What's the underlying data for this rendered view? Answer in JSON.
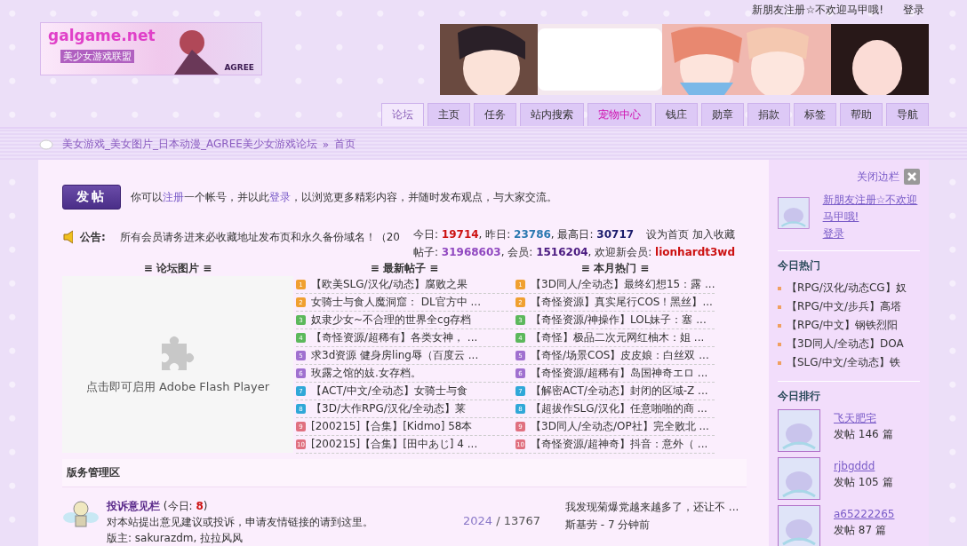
{
  "top_links": [
    "新朋友注册☆不欢迎马甲哦!",
    "登录"
  ],
  "logo": {
    "title": "galgame.net",
    "subtitle": "美少女游戏联盟",
    "badge": "AGREE"
  },
  "banner": {
    "kind": "picture"
  },
  "nav_tabs": [
    {
      "label": "论坛",
      "selected": true,
      "highlight": false
    },
    {
      "label": "主页",
      "selected": false,
      "highlight": false
    },
    {
      "label": "任务",
      "selected": false,
      "highlight": false
    },
    {
      "label": "站内搜索",
      "selected": false,
      "highlight": false
    },
    {
      "label": "宠物中心",
      "selected": false,
      "highlight": true
    },
    {
      "label": "钱庄",
      "selected": false,
      "highlight": false
    },
    {
      "label": "勋章",
      "selected": false,
      "highlight": false
    },
    {
      "label": "捐款",
      "selected": false,
      "highlight": false
    },
    {
      "label": "标签",
      "selected": false,
      "highlight": false
    },
    {
      "label": "帮助",
      "selected": false,
      "highlight": false
    },
    {
      "label": "导航",
      "selected": false,
      "highlight": false
    }
  ],
  "breadcrumb": {
    "path": "美女游戏_美女图片_日本动漫_AGREE美少女游戏论坛",
    "separator": "»",
    "current": "首页"
  },
  "post_button": "发帖",
  "intro": {
    "before": "你可以",
    "register": "注册",
    "middle": "一个帐号，并以此",
    "login": "登录",
    "after": "，以浏览更多精彩内容，并随时发布观点，与大家交流。"
  },
  "notice": {
    "label": "公告:",
    "text": "所有会员请务进来必收藏地址发布页和永久备份域名！（20"
  },
  "stats": {
    "line1": [
      {
        "label": "今日: ",
        "value": "19714",
        "color": "#cc1111"
      },
      {
        "label": ", 昨日: ",
        "value": "23786",
        "color": "#2a78b0"
      },
      {
        "label": ", 最高日: ",
        "value": "30717",
        "color": "#1c1c6c"
      }
    ],
    "links": [
      "设为首页",
      "加入收藏"
    ],
    "line2": [
      {
        "label": "帖子: ",
        "value": "31968603",
        "color": "#9048c0"
      },
      {
        "label": ", 会员: ",
        "value": "1516204",
        "color": "#4a1a80"
      },
      {
        "label": ", 欢迎新会员: ",
        "value": "lionhardt3wd",
        "color": "#cc1111"
      }
    ]
  },
  "picture_panel": {
    "title": "≡ 论坛图片 ≡",
    "message": "点击即可启用 Adobe Flash Player"
  },
  "latest": {
    "title": "≡ 最新帖子 ≡",
    "items": [
      {
        "rank": "1",
        "color": "#f0a030",
        "text": "【欧美SLG/汉化/动态】腐败之果"
      },
      {
        "rank": "2",
        "color": "#f0a030",
        "text": "女骑士与食人魔洞窟： DL官方中 ..."
      },
      {
        "rank": "3",
        "color": "#5cb85c",
        "text": "奴隶少女~不合理的世界全cg存档"
      },
      {
        "rank": "4",
        "color": "#5cb85c",
        "text": "【奇怪资源/超稀有】各类女神， ..."
      },
      {
        "rank": "5",
        "color": "#a070d0",
        "text": "求3d资源 健身房ling辱（百度云 ..."
      },
      {
        "rank": "6",
        "color": "#a070d0",
        "text": "玫露之馆的妓.女存档。"
      },
      {
        "rank": "7",
        "color": "#30a8d8",
        "text": "【ACT/中文/全动态】女骑士与食"
      },
      {
        "rank": "8",
        "color": "#30a8d8",
        "text": "【3D/大作RPG/汉化/全动态】莱"
      },
      {
        "rank": "9",
        "color": "#e07080",
        "text": "[200215]【合集】[Kidmo] 58本"
      },
      {
        "rank": "10",
        "color": "#e07080",
        "text": "[200215]【合集】[田中あじ] 4 ..."
      }
    ]
  },
  "hot": {
    "title": "≡ 本月热门 ≡",
    "items": [
      {
        "rank": "1",
        "color": "#f0a030",
        "text": "【3D同人/全动态】最终幻想15：露 ..."
      },
      {
        "rank": "2",
        "color": "#f0a030",
        "text": "【奇怪资源】真实尾行COS！黑丝】..."
      },
      {
        "rank": "3",
        "color": "#5cb85c",
        "text": "【奇怪资源/神操作】LOL妹子：塞 ..."
      },
      {
        "rank": "4",
        "color": "#5cb85c",
        "text": "【奇怪】极品二次元网红柚木：姐 ..."
      },
      {
        "rank": "5",
        "color": "#a070d0",
        "text": "【奇怪/场景COS】皮皮娘：白丝双 ..."
      },
      {
        "rank": "6",
        "color": "#a070d0",
        "text": "【奇怪资源/超稀有】岛国神奇エロ ..."
      },
      {
        "rank": "7",
        "color": "#30a8d8",
        "text": "【解密ACT/全动态】封闭的区域-Z ..."
      },
      {
        "rank": "8",
        "color": "#30a8d8",
        "text": "【超拔作SLG/汉化】任意啪啪的商 ..."
      },
      {
        "rank": "9",
        "color": "#e07080",
        "text": "【3D同人/全动态/OP社】完全败北 ..."
      },
      {
        "rank": "10",
        "color": "#e07080",
        "text": "【奇怪资源/超神奇】抖音：意外（ ..."
      }
    ]
  },
  "section": {
    "title": "版务管理区"
  },
  "forum": {
    "name": "投诉意见栏",
    "today_open": "(今日: ",
    "today": "8",
    "today_close": ")",
    "description": "对本站提出意见建议或投诉，申请友情链接的请到这里。",
    "moderators": "版主: sakurazdm, 拉拉风风",
    "topics": "2024",
    "separator": " / ",
    "posts": "13767",
    "last_post": "我发现菊爆党越来越多了，还让不 ...",
    "last_by": "斯基劳 - 7 分钟前"
  },
  "sidebar": {
    "close_label": "关闭边栏",
    "welcome_link": "新朋友注册☆不欢迎马甲哦!",
    "login_link": "登录",
    "hot_title": "今日热门",
    "hot_items": [
      "【RPG/汉化/动态CG】奴",
      "【RPG/中文/步兵】高塔",
      "【RPG/中文】钢铁烈阳",
      "【3D同人/全动态】DOA",
      "【SLG/中文/全动态】铁"
    ],
    "rank_title": "今日排行",
    "rank": [
      {
        "name": "飞天肥宅",
        "posts": "发帖 146 篇"
      },
      {
        "name": "rjbgddd",
        "posts": "发帖 105 篇"
      },
      {
        "name": "a65222265",
        "posts": "发帖 87 篇"
      }
    ]
  }
}
